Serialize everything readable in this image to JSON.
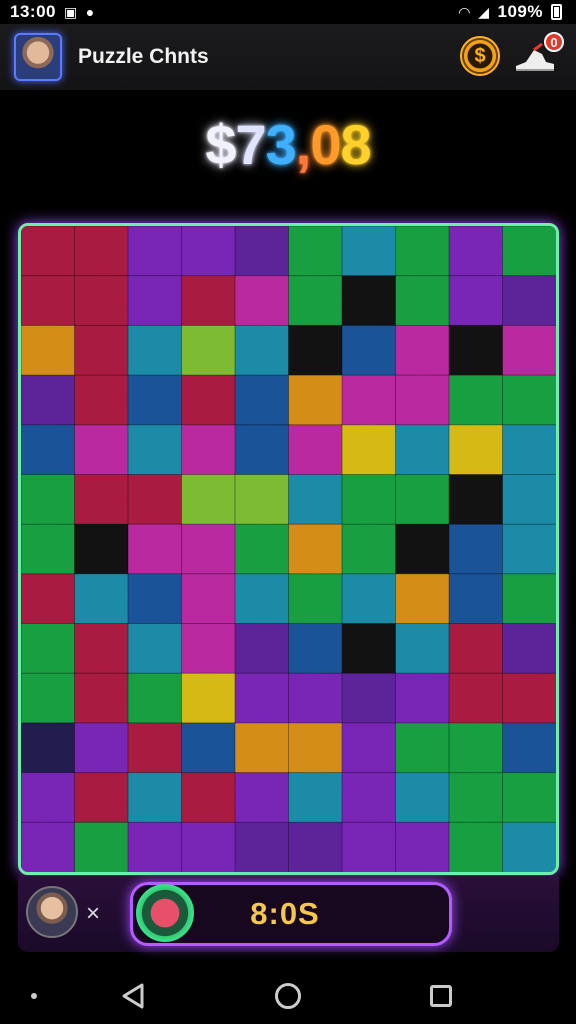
{
  "status_bar": {
    "time": "13:00",
    "battery": "109%"
  },
  "header": {
    "title": "Puzzle Chnts",
    "notification_count": "0",
    "icons": [
      "profile-avatar",
      "coin-icon",
      "sneaker-icon"
    ]
  },
  "score": {
    "text": "$73,08",
    "colors": [
      "#f2f2ff",
      "#e0e4ff",
      "#3fb0ff",
      "#ff7a3a",
      "#ff9a2a",
      "#ffd12a",
      "#ffee40"
    ]
  },
  "board": {
    "rows": 13,
    "cols": 10,
    "palette": {
      "R": "#c21f4a",
      "P": "#8a2bd0",
      "M": "#d42fb5",
      "G": "#1bb54a",
      "T": "#1f9fbf",
      "B": "#1f5fae",
      "O": "#f2a21c",
      "Y": "#f3d317",
      "K": "#151515",
      "L": "#8fd63a",
      "V": "#6a2ab0",
      "D": "#27205a"
    },
    "grid": [
      "RRPPVGTGPG",
      "RRPRMGKGPV",
      "ORTLTKBMKM",
      "VRBRBOMMGG",
      "BMTMBMYTYT",
      "GRRLLTGGKT",
      "GKMMGOGKBT",
      "RTBMTGTOBG",
      "GRTMVBKTRV",
      "GRGYPPVPRR",
      "DPRBOOPGGB",
      "PRTRPTPTGG",
      "PGPPVVPPGT"
    ]
  },
  "bottom_bar": {
    "multiplier": "×",
    "timer": "8:0S"
  }
}
